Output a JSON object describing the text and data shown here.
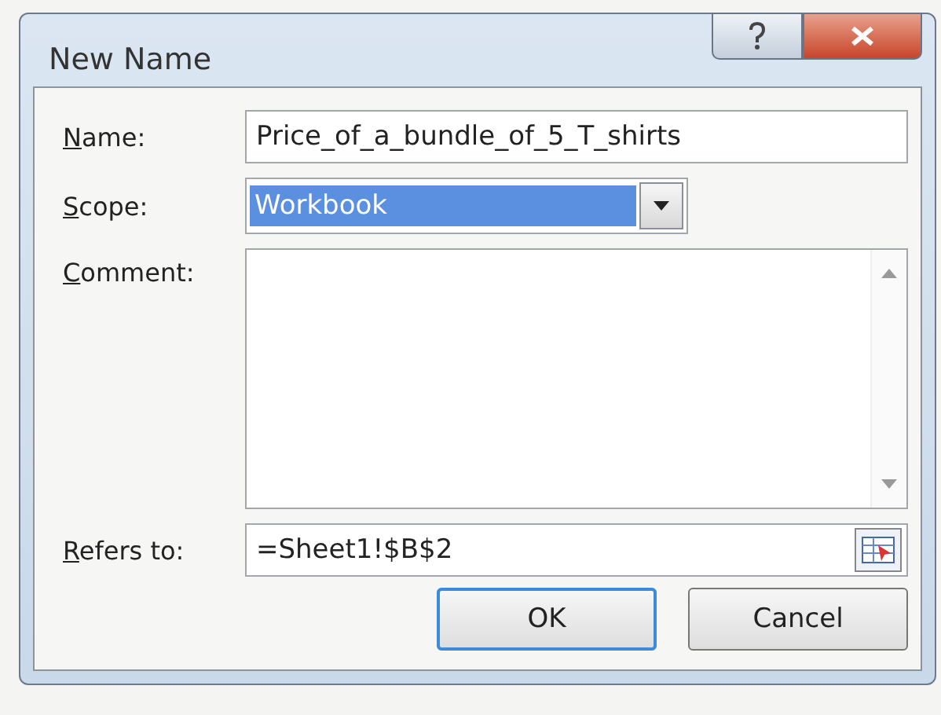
{
  "window": {
    "title": "New Name"
  },
  "fields": [
    {
      "kind": "text",
      "label": "Name:",
      "value": "Price_of_a_bundle_of_5_T_shirts"
    },
    {
      "kind": "combo",
      "label": "Scope:",
      "value": "Workbook",
      "selected": true
    },
    {
      "kind": "memo",
      "label": "Comment:"
    },
    {
      "kind": "reference",
      "label": "Refers to:",
      "value": "=Sheet1!$B$2"
    }
  ],
  "buttons": [
    {
      "label": "OK",
      "default": true
    },
    {
      "label": "Cancel",
      "default": false
    }
  ]
}
